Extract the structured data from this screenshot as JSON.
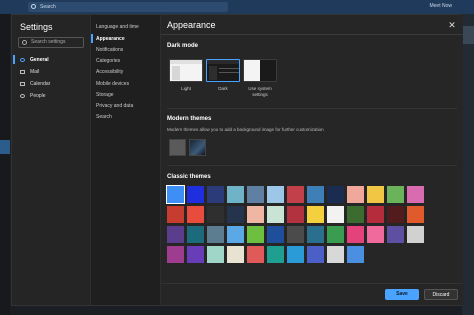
{
  "app": {
    "search_placeholder": "Search",
    "meet_now": "Meet Now"
  },
  "settings": {
    "title": "Settings",
    "search_placeholder": "Search settings",
    "categories": [
      {
        "label": "General",
        "icon": "gear-icon"
      },
      {
        "label": "Mail",
        "icon": "mail-icon"
      },
      {
        "label": "Calendar",
        "icon": "calendar-icon"
      },
      {
        "label": "People",
        "icon": "people-icon"
      }
    ],
    "subcategories": [
      "Language and time",
      "Appearance",
      "Notifications",
      "Categories",
      "Accessibility",
      "Mobile devices",
      "Storage",
      "Privacy and data",
      "Search"
    ]
  },
  "pane": {
    "title": "Appearance",
    "dark_mode": {
      "title": "Dark mode",
      "options": [
        "Light",
        "Dark",
        "Use system settings"
      ],
      "selected": "Dark"
    },
    "modern_themes": {
      "title": "Modern themes",
      "description": "Modern themes allow you to add a background image for further customization"
    },
    "classic_themes": {
      "title": "Classic themes",
      "tile_colors": [
        "#3d8ff5",
        "#1f2fe0",
        "#2b3b7a",
        "#6fb3c9",
        "#5f7fa3",
        "#9cc7e8",
        "#c2404a",
        "#3e7fb8",
        "#1a2c4f",
        "#f0a89a",
        "#f1c645",
        "#6bb35a",
        "#d96bb0",
        "#c63d2f",
        "#e74c3c",
        "#2f2f2f",
        "#24344d",
        "#efb6a4",
        "#c9e3d5",
        "#b23240",
        "#f4d03f",
        "#f2f2f2",
        "#3c6b2f",
        "#b52d3c",
        "#521c1c",
        "#e05a2b",
        "#5a3d8c",
        "#1c6b7d",
        "#5b7d8f",
        "#5aa9e6",
        "#6cbf3f",
        "#1f4f9c",
        "#4b4b4b",
        "#2b6f8f",
        "#3a9c4f",
        "#e3437a",
        "#f06b9b",
        "#5f4fa3",
        "#d1d1d1",
        "#9e3c8f",
        "#6a3db8",
        "#9fd6c8",
        "#e8e2d0",
        "#e05a5a",
        "#1f9f8f",
        "#2b9bd8",
        "#4b5fc7",
        "#d8d8d8",
        "#4a8fe0"
      ]
    }
  },
  "footer": {
    "save": "Save",
    "discard": "Discard"
  }
}
